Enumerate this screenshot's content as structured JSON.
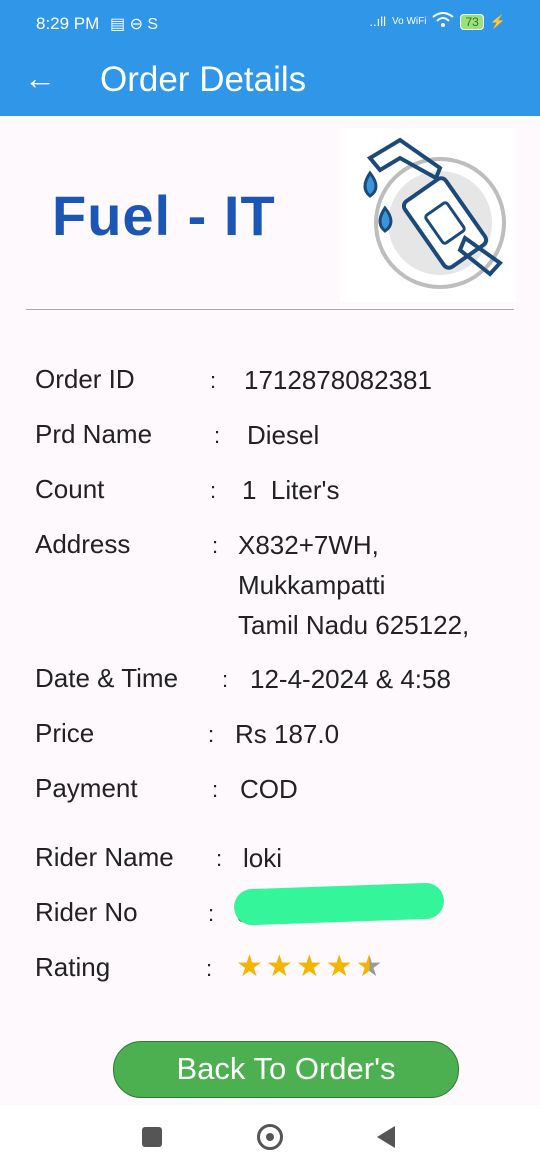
{
  "status_bar": {
    "time": "8:29 PM",
    "left_icons": "▤ ⊖ S",
    "signal": "..ıll",
    "vowifi": "Vo WiFi",
    "wifi_icon": "wifi-icon",
    "battery": "73",
    "charging_icon": "⚡"
  },
  "appbar": {
    "back_icon": "←",
    "title": "Order Details"
  },
  "brand": {
    "name": "Fuel - IT"
  },
  "order": {
    "labels": {
      "order_id": "Order ID",
      "prd_name": "Prd Name",
      "count": "Count",
      "address": "Address",
      "date_time": "Date & Time",
      "price": "Price",
      "payment": "Payment",
      "rider_name": "Rider Name",
      "rider_no": "Rider No",
      "rating": "Rating"
    },
    "colon": ":",
    "values": {
      "order_id": "1712878082381",
      "prd_name": "Diesel",
      "count": "1  Liter's",
      "address_line1": "X832+7WH,",
      "address_line2": "Mukkampatti",
      "address_line3": "Tamil Nadu 625122,",
      "date_time": "12-4-2024 & 4:58",
      "price": "Rs 187.0",
      "payment": "COD",
      "rider_name": "loki",
      "rider_no_visible": "8"
    },
    "rating": 4.5
  },
  "button": {
    "back_to_orders": "Back To Order's"
  }
}
